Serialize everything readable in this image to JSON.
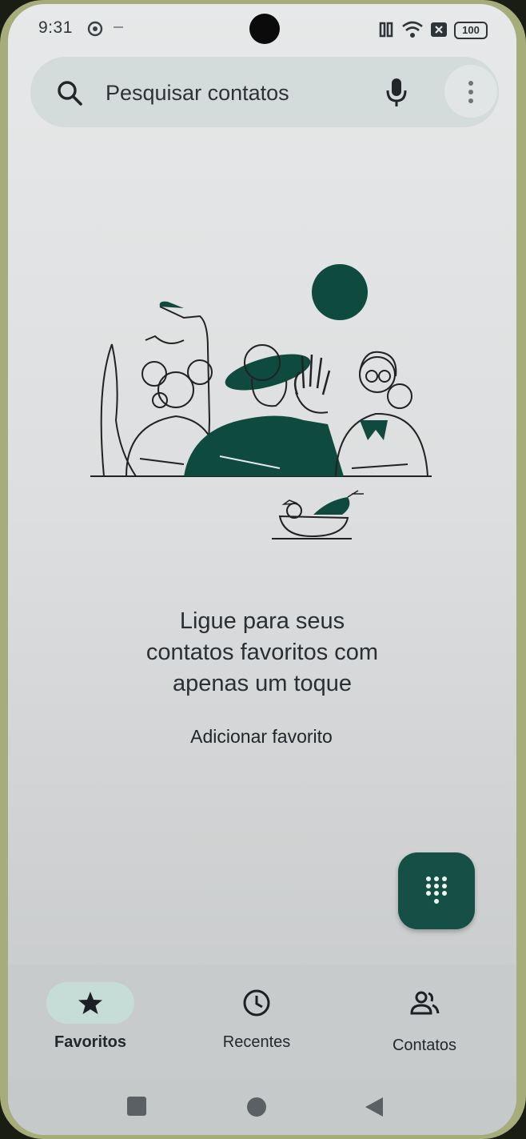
{
  "status_bar": {
    "time": "9:31",
    "battery": "100"
  },
  "search": {
    "placeholder": "Pesquisar contatos",
    "search_icon": "search-icon",
    "mic_icon": "microphone-icon",
    "more_icon": "more-vert-icon"
  },
  "empty_state": {
    "title_line1": "Ligue para seus",
    "title_line2": "contatos favoritos com",
    "title_line3": "apenas um toque",
    "action": "Adicionar favorito"
  },
  "fab": {
    "icon": "dialpad-icon"
  },
  "bottom_nav": {
    "items": [
      {
        "label": "Favoritos",
        "icon": "star-icon",
        "active": true
      },
      {
        "label": "Recentes",
        "icon": "clock-icon",
        "active": false
      },
      {
        "label": "Contatos",
        "icon": "people-icon",
        "active": false
      }
    ]
  },
  "system_nav": {
    "recents": "square-icon",
    "home": "circle-icon",
    "back": "triangle-back-icon"
  },
  "colors": {
    "accent": "#164f45",
    "nav_active_pill": "#c6dcd6",
    "search_bar": "#d3dbdb"
  }
}
